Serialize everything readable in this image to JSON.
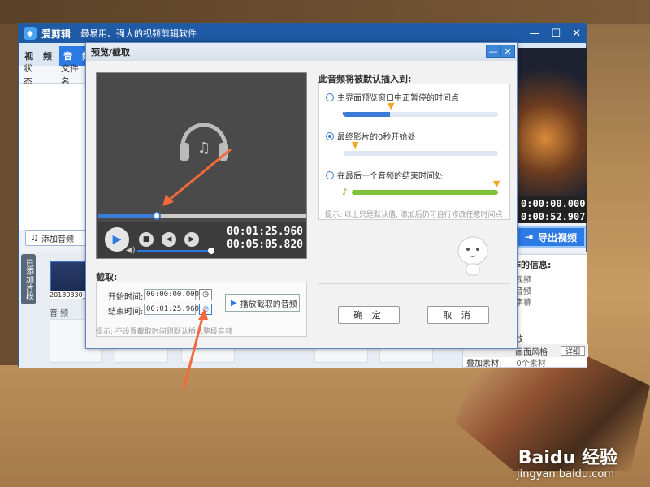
{
  "app": {
    "name": "爱剪辑",
    "slogan": "最易用、强大的视频剪辑软件",
    "tabs": [
      "视 频",
      "音 频"
    ],
    "list_headers": [
      "状态",
      "文件名"
    ],
    "add_audio_label": "添加音频",
    "side_label": "已添加片段",
    "clip_name": "20180330_1",
    "audio_section": "音 频",
    "preview_times": [
      "0:00:00.000",
      "0:00:52.907"
    ],
    "export_label": "导出视频",
    "info": {
      "title": "作的信息:",
      "items": [
        "视频",
        "音频",
        "字幕"
      ],
      "row1_left": "效",
      "row2_left": "画面风格",
      "detail_label": "详细",
      "row3_left": "叠加素材:",
      "row3_value": "0个素材"
    }
  },
  "dialog": {
    "title": "预览/截取",
    "player": {
      "current_time": "00:01:25.960",
      "total_time": "00:05:05.820",
      "progress": 0.28
    },
    "cut": {
      "title": "截取:",
      "start_label": "开始时间:",
      "start_value": "00:00:00.000",
      "end_label": "结束时间:",
      "end_value": "00:01:25.960",
      "play_cut_label": "播放截取的音频",
      "hint": "提示: 不设置截取时间则默认插入整段音频"
    },
    "insert": {
      "title": "此音频将被默认插入到:",
      "options": [
        "主界面预览窗口中正暂停的时间点",
        "最终影片的0秒开始处",
        "在最后一个音频的结束时间处"
      ],
      "selected_index": 1,
      "hint": "提示: 以上只是默认值, 添加后仍可自行修改任意时间点"
    },
    "ok_label": "确 定",
    "cancel_label": "取 消"
  },
  "watermark": {
    "brand": "Baidu 经验",
    "url": "jingyan.baidu.com"
  }
}
